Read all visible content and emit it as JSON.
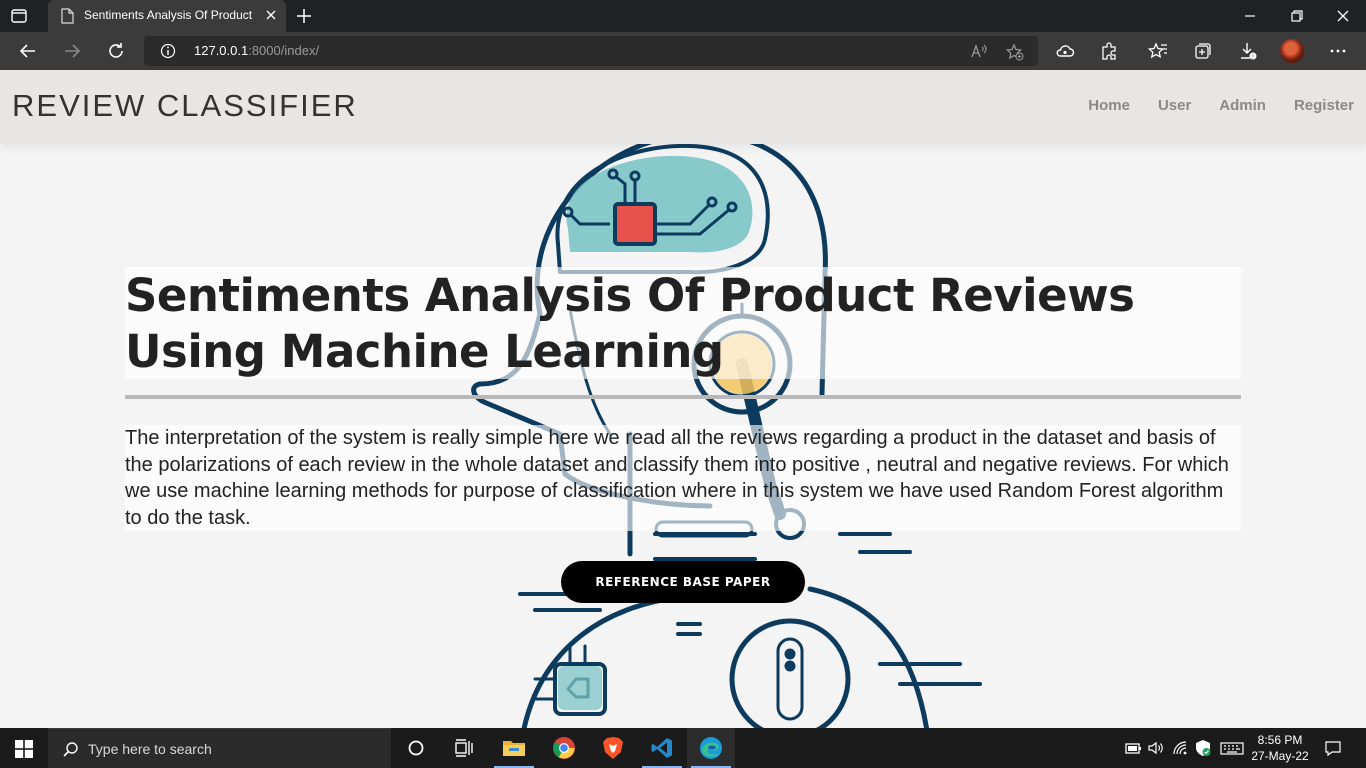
{
  "browser": {
    "tab_title": "Sentiments Analysis Of Product Reviews Using Machine Learning",
    "url_host": "127.0.0.1",
    "url_path": ":8000/index/"
  },
  "site": {
    "brand": "REVIEW CLASSIFIER",
    "nav": [
      "Home",
      "User",
      "Admin",
      "Register"
    ]
  },
  "hero": {
    "title": "Sentiments Analysis Of Product Reviews Using Machine Learning",
    "description": "The interpretation of the system is really simple here we read all the reviews regarding a product in the dataset and basis of the polarizations of each review in the whole dataset and classify them into positive , neutral and negative reviews. For which we use machine learning methods for purpose of classification where in this system we have used Random Forest algorithm to do the task.",
    "button": "REFERENCE BASE PAPER"
  },
  "taskbar": {
    "search_placeholder": "Type here to search",
    "time": "8:56 PM",
    "date": "27-May-22"
  },
  "colors": {
    "robot_outline": "#0d3b5e",
    "robot_teal": "#7cc4c6",
    "robot_red": "#e8524d",
    "robot_yellow": "#f5c35c",
    "button_bg": "#000000"
  }
}
